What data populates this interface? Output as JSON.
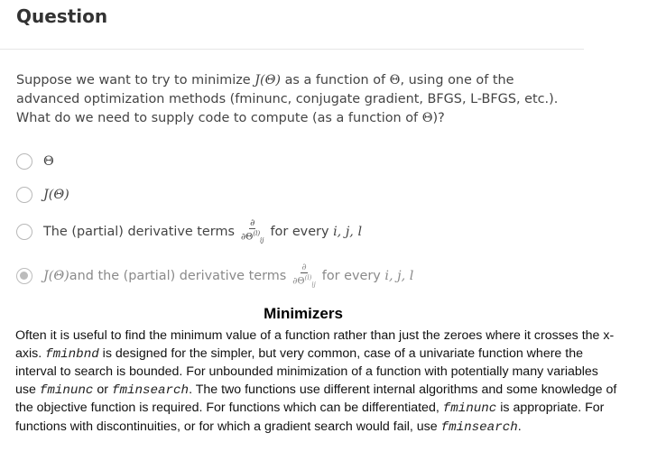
{
  "header": {
    "title": "Question"
  },
  "prompt": {
    "part1": "Suppose we want to try to minimize ",
    "j_theta": "J(Θ)",
    "part2": " as a function of ",
    "theta": "Θ",
    "part3": ", using one of the advanced optimization methods (fminunc, conjugate gradient, BFGS, L-BFGS, etc.). What do we need to supply code to compute (as a function of ",
    "theta2": "Θ",
    "part4": ")?"
  },
  "options": [
    {
      "label": "Θ",
      "selected": false
    },
    {
      "label": "J(Θ)",
      "selected": false
    },
    {
      "text": "The (partial) derivative terms",
      "frac_num": "∂",
      "frac_den": "∂Θ",
      "frac_sup": "(l)",
      "frac_sub": "ij",
      "suffix_text": "for every ",
      "suffix_vars": "i, j, l",
      "selected": false
    },
    {
      "prefix": "J(Θ)",
      "text": " and the (partial) derivative terms",
      "frac_num": "∂",
      "frac_den": "∂Θ",
      "frac_sup": "(l)",
      "frac_sub": "ij",
      "suffix_text": "for every ",
      "suffix_vars": "i, j, l",
      "selected": true
    }
  ],
  "minimizers": {
    "title": "Minimizers",
    "t1": "Often it is useful to find the minimum value of a function rather than just the zeroes where it crosses the x-axis. ",
    "c1": "fminbnd",
    "t2": " is designed for the simpler, but very common, case of a univariate function where the interval to search is bounded. For unbounded minimization of a function with potentially many variables use ",
    "c2": "fminunc",
    "t3": " or ",
    "c3": "fminsearch",
    "t4": ". The two functions use different internal algorithms and some knowledge of the objective function is required. For functions which can be differentiated, ",
    "c4": "fminunc",
    "t5": " is appropriate. For functions with discontinuities, or for which a gradient search would fail, use ",
    "c5": "fminsearch",
    "t6": "."
  }
}
